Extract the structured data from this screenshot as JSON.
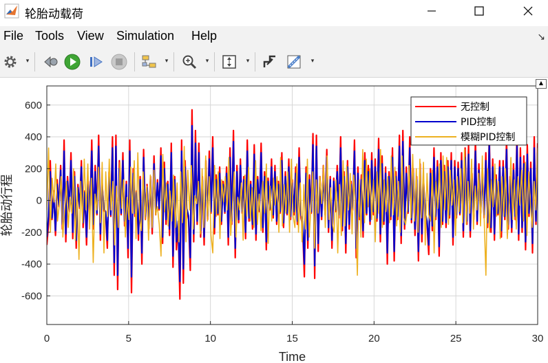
{
  "window": {
    "title": "轮胎动载荷",
    "icon": "matlab-icon",
    "controls": [
      "minimize-icon",
      "maximize-icon",
      "close-icon"
    ]
  },
  "menu": {
    "file": "File",
    "tools": "Tools",
    "view": "View",
    "simulation": "Simulation",
    "help": "Help"
  },
  "toolbar": {
    "icons": [
      "settings-gear-icon",
      "step-back-icon",
      "run-icon",
      "step-forward-icon",
      "stop-icon",
      "signal-selector-icon",
      "zoom-in-icon",
      "autoscale-icon",
      "highlight-block-icon",
      "style-ruler-icon"
    ]
  },
  "colors": {
    "no_control": "#ff0000",
    "pid": "#0000cc",
    "fuzzy_pid": "#edb120",
    "grid": "#d6d6d6",
    "axes": "#262626"
  },
  "chart_data": {
    "type": "line",
    "title": "",
    "xlabel": "Time",
    "ylabel": "轮胎动行程",
    "xlim": [
      0,
      30
    ],
    "ylim": [
      -780,
      720
    ],
    "xticks": [
      0,
      5,
      10,
      15,
      20,
      25,
      30
    ],
    "yticks": [
      600,
      400,
      200,
      0,
      -200,
      -400,
      -600
    ],
    "grid": true,
    "legend_position": "top-right",
    "sample_step": 0.1,
    "series": [
      {
        "name": "无控制",
        "color": "#ff0000",
        "values": [
          -280,
          -150,
          250,
          -120,
          60,
          -220,
          130,
          -40,
          220,
          -180,
          380,
          -260,
          150,
          -70,
          300,
          -240,
          180,
          -300,
          100,
          -50,
          250,
          -170,
          60,
          -280,
          120,
          -60,
          380,
          -180,
          220,
          -90,
          410,
          -250,
          120,
          -60,
          -80,
          -300,
          180,
          -100,
          400,
          -470,
          410,
          -560,
          250,
          -90,
          300,
          -160,
          120,
          -360,
          380,
          -580,
          200,
          -100,
          60,
          -250,
          150,
          -400,
          320,
          -120,
          100,
          -180,
          150,
          -210,
          280,
          -90,
          130,
          -60,
          330,
          -270,
          240,
          -150,
          120,
          -220,
          360,
          -420,
          150,
          -310,
          -150,
          -620,
          380,
          -520,
          250,
          -60,
          -120,
          -440,
          570,
          -260,
          440,
          -150,
          360,
          -230,
          150,
          -280,
          250,
          -120,
          310,
          -80,
          400,
          -210,
          160,
          -90,
          210,
          -150,
          120,
          -80,
          210,
          -280,
          330,
          -150,
          440,
          -360,
          220,
          -140,
          260,
          -80,
          150,
          -240,
          380,
          -130,
          120,
          -180,
          350,
          -250,
          150,
          -70,
          360,
          -200,
          180,
          -310,
          140,
          -60,
          260,
          -110,
          220,
          -150,
          120,
          -80,
          300,
          -170,
          180,
          -90,
          260,
          -120,
          130,
          -90,
          210,
          -150,
          330,
          -110,
          -160,
          -480,
          210,
          -300,
          160,
          -80,
          420,
          -490,
          410,
          -320,
          150,
          -120,
          220,
          -90,
          320,
          -200,
          150,
          -300,
          140,
          -70,
          220,
          -110,
          400,
          -190,
          180,
          -330,
          250,
          -180,
          120,
          -60,
          380,
          -360,
          210,
          -120,
          160,
          -230,
          300,
          -90,
          220,
          -150,
          300,
          -90,
          260,
          -130,
          390,
          -260,
          280,
          -150,
          210,
          -400,
          180,
          -120,
          330,
          -380,
          180,
          -120,
          410,
          -270,
          440,
          -180,
          210,
          -80,
          400,
          -140,
          200,
          -220,
          150,
          -380,
          230,
          -260,
          120,
          -90,
          -150,
          -340,
          200,
          -190,
          330,
          -120,
          250,
          -350,
          300,
          -150,
          220,
          -170,
          250,
          -110,
          300,
          -280,
          250,
          -110,
          240,
          -90,
          300,
          -230,
          330,
          -150,
          350,
          -230,
          170,
          -120,
          380,
          -150,
          230,
          -80,
          200,
          -110,
          300,
          -170,
          420,
          -200,
          260,
          -250,
          160,
          -90,
          250,
          -230,
          250,
          -120,
          390,
          -180,
          150,
          -200,
          230,
          -120,
          410,
          -250,
          330,
          -200,
          280,
          -310,
          350,
          -100,
          240,
          -330,
          400,
          -150,
          360
        ]
      },
      {
        "name": "PID控制",
        "color": "#0000cc",
        "values": [
          -230,
          -100,
          180,
          -110,
          40,
          -190,
          100,
          -30,
          190,
          -150,
          310,
          -210,
          120,
          -60,
          250,
          -200,
          150,
          -250,
          80,
          -40,
          210,
          -140,
          50,
          -230,
          100,
          -50,
          310,
          -150,
          180,
          -80,
          340,
          -210,
          100,
          -50,
          -70,
          -250,
          150,
          -90,
          330,
          -390,
          340,
          -470,
          200,
          -80,
          250,
          -130,
          100,
          -300,
          310,
          -480,
          170,
          -80,
          50,
          -210,
          130,
          -330,
          270,
          -100,
          80,
          -150,
          130,
          -170,
          230,
          -70,
          110,
          -50,
          280,
          -230,
          200,
          -120,
          100,
          -180,
          300,
          -350,
          130,
          -260,
          -130,
          -510,
          310,
          -430,
          210,
          -50,
          -100,
          -360,
          470,
          -210,
          360,
          -130,
          300,
          -190,
          130,
          -230,
          210,
          -100,
          260,
          -70,
          330,
          -170,
          130,
          -80,
          170,
          -130,
          100,
          -70,
          170,
          -230,
          270,
          -130,
          370,
          -300,
          180,
          -120,
          220,
          -70,
          130,
          -200,
          310,
          -110,
          100,
          -150,
          290,
          -210,
          130,
          -60,
          300,
          -170,
          150,
          -260,
          120,
          -50,
          210,
          -90,
          180,
          -130,
          100,
          -70,
          250,
          -140,
          150,
          -80,
          210,
          -100,
          110,
          -70,
          170,
          -130,
          270,
          -90,
          -130,
          -400,
          170,
          -250,
          130,
          -70,
          350,
          -410,
          340,
          -270,
          130,
          -100,
          180,
          -80,
          270,
          -170,
          130,
          -250,
          120,
          -60,
          180,
          -90,
          330,
          -160,
          150,
          -270,
          210,
          -150,
          100,
          -50,
          310,
          -300,
          170,
          -100,
          130,
          -190,
          250,
          -80,
          180,
          -130,
          250,
          -70,
          210,
          -110,
          320,
          -210,
          230,
          -130,
          170,
          -330,
          150,
          -100,
          270,
          -320,
          150,
          -100,
          340,
          -220,
          370,
          -150,
          170,
          -70,
          330,
          -120,
          170,
          -180,
          130,
          -320,
          190,
          -210,
          100,
          -80,
          -130,
          -280,
          170,
          -160,
          270,
          -100,
          210,
          -290,
          250,
          -130,
          180,
          -140,
          210,
          -90,
          250,
          -230,
          210,
          -90,
          200,
          -80,
          250,
          -190,
          270,
          -130,
          290,
          -190,
          140,
          -100,
          310,
          -130,
          190,
          -70,
          170,
          -90,
          250,
          -140,
          350,
          -170,
          210,
          -210,
          130,
          -80,
          210,
          -190,
          210,
          -100,
          320,
          -150,
          130,
          -170,
          190,
          -100,
          340,
          -210,
          270,
          -170,
          230,
          -260,
          290,
          -80,
          200,
          -270,
          330,
          -130,
          300
        ]
      },
      {
        "name": "模糊PID控制",
        "color": "#edb120",
        "values": [
          -60,
          330,
          -200,
          140,
          -10,
          230,
          -130,
          -30,
          150,
          -230,
          -60,
          120,
          -170,
          20,
          -80,
          200,
          -250,
          80,
          -370,
          120,
          -140,
          260,
          -60,
          230,
          -180,
          140,
          -390,
          40,
          -60,
          210,
          -140,
          240,
          -330,
          180,
          -100,
          260,
          -60,
          120,
          -280,
          90,
          -170,
          240,
          -50,
          130,
          -230,
          20,
          -120,
          210,
          -80,
          250,
          -240,
          300,
          -110,
          -190,
          180,
          -120,
          90,
          -250,
          160,
          -170,
          190,
          -90,
          -40,
          -150,
          -350,
          290,
          -70,
          110,
          -160,
          60,
          -130,
          160,
          -170,
          110,
          -260,
          180,
          -140,
          340,
          -260,
          190,
          -60,
          220,
          -180,
          30,
          -20,
          120,
          -210,
          200,
          -170,
          280,
          -130,
          150,
          -220,
          -330,
          220,
          -100,
          180,
          -240,
          130,
          -10,
          150,
          -60,
          270,
          -220,
          -40,
          180,
          -230,
          20,
          -60,
          110,
          -250,
          160,
          -100,
          210,
          -130,
          80,
          -170,
          250,
          -150,
          40,
          -190,
          120,
          -80,
          230,
          -270,
          90,
          -130,
          140,
          -30,
          150,
          -200,
          270,
          -160,
          100,
          -80,
          180,
          -200,
          260,
          -100,
          -170,
          230,
          -200,
          110,
          -260,
          100,
          -180,
          260,
          -230,
          -40,
          180,
          -300,
          130,
          -80,
          150,
          -20,
          220,
          -170,
          280,
          -120,
          80,
          -150,
          -200,
          130,
          -330,
          100,
          -220,
          250,
          -160,
          220,
          -60,
          170,
          -210,
          160,
          -50,
          -470,
          130,
          -230,
          320,
          -140,
          260,
          -40,
          200,
          -120,
          130,
          -260,
          180,
          -80,
          320,
          -170,
          130,
          -70,
          150,
          -140,
          280,
          -90,
          210,
          -160,
          120,
          -200,
          280,
          -110,
          -150,
          -60,
          220,
          -110,
          290,
          -130,
          200,
          -200,
          260,
          -110,
          240,
          -280,
          170,
          -90,
          -130,
          190,
          -330,
          120,
          -50,
          230,
          -170,
          280,
          -60,
          270,
          -150,
          190,
          -30,
          130,
          -220,
          150,
          -70,
          200,
          -140,
          320,
          -150,
          120,
          -80,
          260,
          -180,
          90,
          -60,
          170,
          -160,
          280,
          -100,
          -470,
          200,
          -200,
          130,
          -40,
          230,
          -100,
          120,
          -240,
          150,
          -100,
          200,
          -240,
          -20,
          270,
          -120,
          130,
          -180,
          150,
          -30,
          190,
          -130,
          240,
          -220,
          180,
          -30,
          -170,
          120,
          -60,
          330
        ]
      }
    ]
  }
}
